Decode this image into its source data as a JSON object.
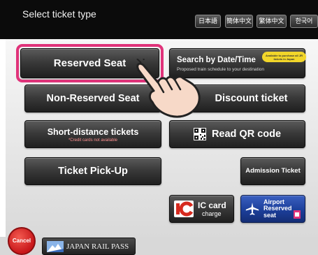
{
  "header": {
    "title": "Select ticket type",
    "languages": [
      "日本語",
      "簡体中文",
      "繁体中文",
      "한국어"
    ]
  },
  "buttons": {
    "reserved_seat": "Reserved Seat",
    "search_by_date": {
      "label": "Search by Date/Time",
      "sub": "Proposed train schedule to your destination",
      "badge": "Available to purchase all JR tickets in Japan"
    },
    "non_reserved_seat": "Non-Reserved Seat",
    "discount_ticket": "Discount ticket",
    "short_distance": {
      "label": "Short-distance tickets",
      "note": "*Credit cards not available"
    },
    "read_qr": "Read QR code",
    "ticket_pickup": "Ticket Pick-Up",
    "admission_ticket": "Admission Ticket",
    "ic_card": {
      "line1": "IC card",
      "line2": "charge"
    },
    "airport_reserved": {
      "line1": "Airport",
      "line2": "Reserved",
      "line3": "seat"
    }
  },
  "footer": {
    "cancel": "Cancel",
    "japan_rail_pass": "JAPAN RAIL PASS"
  },
  "colors": {
    "highlight": "#e0337a",
    "cancel_red": "#d61f22",
    "airport_blue": "#1c3f9a",
    "ic_red": "#d62a1f"
  }
}
